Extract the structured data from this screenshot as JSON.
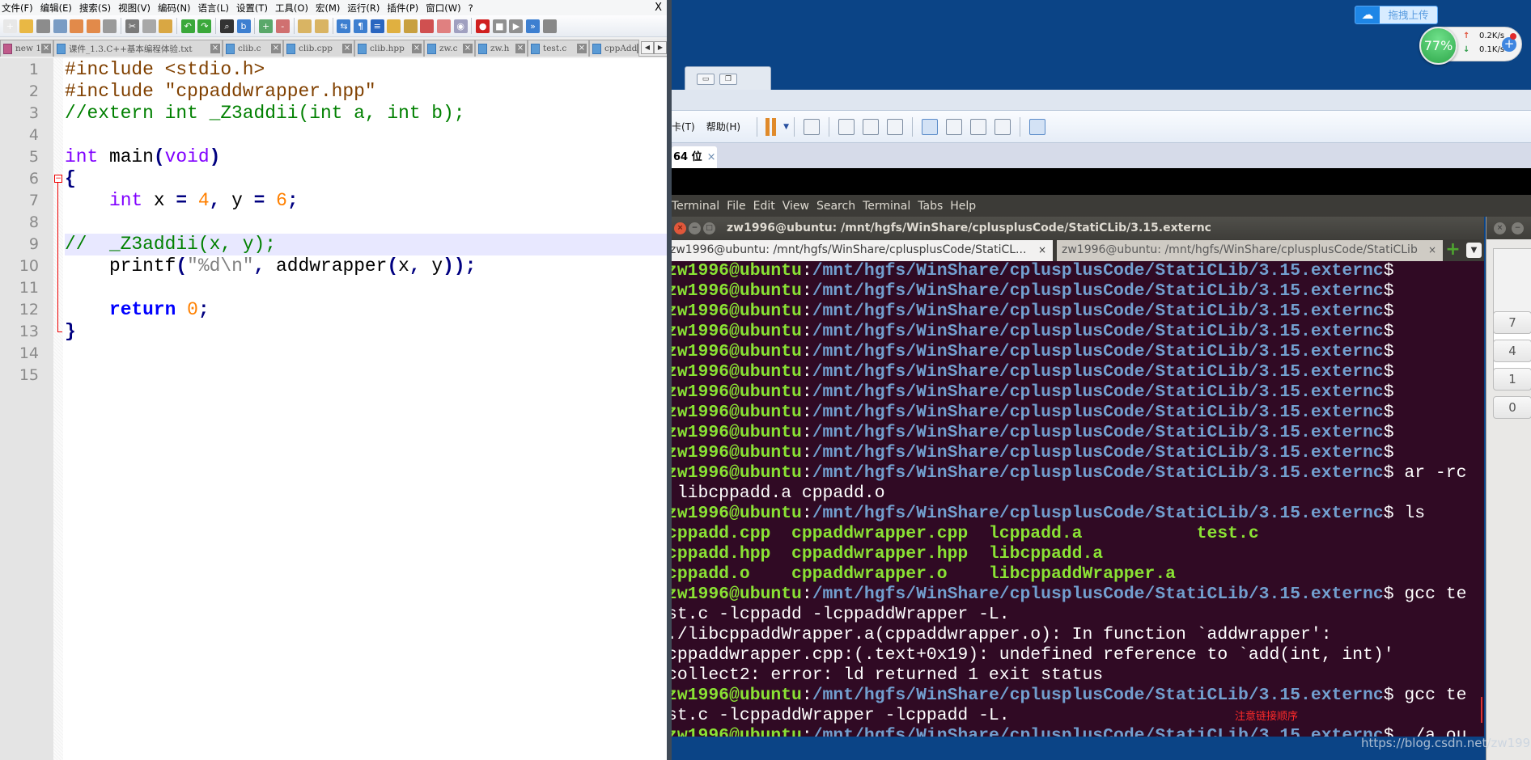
{
  "notepad": {
    "menu": [
      "文件(F)",
      "编辑(E)",
      "搜索(S)",
      "视图(V)",
      "编码(N)",
      "语言(L)",
      "设置(T)",
      "工具(O)",
      "宏(M)",
      "运行(R)",
      "插件(P)",
      "窗口(W)",
      "?"
    ],
    "close_label": "X",
    "toolbar_icons": [
      {
        "name": "new-file",
        "color": "#e8e8e8",
        "glyph": "+"
      },
      {
        "name": "open-file",
        "color": "#e9b844",
        "glyph": ""
      },
      {
        "name": "save",
        "color": "#8c8c8c",
        "glyph": ""
      },
      {
        "name": "save-all",
        "color": "#7a9cc4",
        "glyph": ""
      },
      {
        "name": "close-file",
        "color": "#e28a4a",
        "glyph": ""
      },
      {
        "name": "close-all",
        "color": "#e28a4a",
        "glyph": ""
      },
      {
        "name": "print",
        "color": "#9a9a9a",
        "glyph": ""
      },
      {
        "sep": true
      },
      {
        "name": "cut",
        "color": "#7a7a7a",
        "glyph": "✂"
      },
      {
        "name": "copy",
        "color": "#a8a8a8",
        "glyph": ""
      },
      {
        "name": "paste",
        "color": "#d9a743",
        "glyph": ""
      },
      {
        "sep": true
      },
      {
        "name": "undo",
        "color": "#3aa83a",
        "glyph": "↶"
      },
      {
        "name": "redo",
        "color": "#3aa83a",
        "glyph": "↷"
      },
      {
        "sep": true
      },
      {
        "name": "find",
        "color": "#333333",
        "glyph": "⌕"
      },
      {
        "name": "replace",
        "color": "#3d7fd0",
        "glyph": "b"
      },
      {
        "sep": true
      },
      {
        "name": "zoom-in",
        "color": "#5aa86a",
        "glyph": "+"
      },
      {
        "name": "zoom-out",
        "color": "#d07070",
        "glyph": "-"
      },
      {
        "sep": true
      },
      {
        "name": "sync-vertical",
        "color": "#d9b463",
        "glyph": ""
      },
      {
        "name": "sync-horizontal",
        "color": "#d9b463",
        "glyph": ""
      },
      {
        "sep": true
      },
      {
        "name": "word-wrap",
        "color": "#3d7fd0",
        "glyph": "⇆"
      },
      {
        "name": "show-all-chars",
        "color": "#3d7fd0",
        "glyph": "¶"
      },
      {
        "name": "indent-guide",
        "color": "#2a66c0",
        "glyph": "≡"
      },
      {
        "name": "doc-map",
        "color": "#e0b040",
        "glyph": ""
      },
      {
        "name": "function-list",
        "color": "#c8a040",
        "glyph": ""
      },
      {
        "name": "folder-workspace",
        "color": "#d05050",
        "glyph": ""
      },
      {
        "name": "doc-list",
        "color": "#e08080",
        "glyph": ""
      },
      {
        "name": "monitoring",
        "color": "#a0a0c0",
        "glyph": "◉"
      },
      {
        "sep": true
      },
      {
        "name": "record-macro",
        "color": "#d02020",
        "glyph": "●"
      },
      {
        "name": "stop-record",
        "color": "#909090",
        "glyph": "■"
      },
      {
        "name": "playback",
        "color": "#909090",
        "glyph": "▶"
      },
      {
        "name": "run-macro-multiple",
        "color": "#3d7fd0",
        "glyph": "»"
      },
      {
        "name": "save-macro",
        "color": "#888888",
        "glyph": ""
      }
    ],
    "tabs": [
      {
        "label": "new 1",
        "unsaved": true
      },
      {
        "label": "课件_1.3.C++基本编程体验.txt"
      },
      {
        "label": "clib.c"
      },
      {
        "label": "clib.cpp"
      },
      {
        "label": "clib.hpp"
      },
      {
        "label": "zw.c"
      },
      {
        "label": "zw.h"
      },
      {
        "label": "test.c"
      },
      {
        "label": "cppAdd"
      }
    ],
    "active_line": 9,
    "code": [
      {
        "num": "1",
        "tokens": [
          {
            "t": "#include <stdio.h>",
            "c": "pp"
          }
        ]
      },
      {
        "num": "2",
        "tokens": [
          {
            "t": "#include \"cppaddwrapper.hpp\"",
            "c": "pp"
          }
        ]
      },
      {
        "num": "3",
        "tokens": [
          {
            "t": "//extern int _Z3addii(int a, int b);",
            "c": "cm"
          }
        ]
      },
      {
        "num": "4",
        "tokens": []
      },
      {
        "num": "5",
        "tokens": [
          {
            "t": "int",
            "c": "kw"
          },
          {
            "t": " main"
          },
          {
            "t": "(",
            "c": "op"
          },
          {
            "t": "void",
            "c": "kw"
          },
          {
            "t": ")",
            "c": "op"
          }
        ]
      },
      {
        "num": "6",
        "tokens": [
          {
            "t": "{",
            "c": "op"
          }
        ]
      },
      {
        "num": "7",
        "tokens": [
          {
            "t": "    "
          },
          {
            "t": "int",
            "c": "kw"
          },
          {
            "t": " x "
          },
          {
            "t": "=",
            "c": "op"
          },
          {
            "t": " "
          },
          {
            "t": "4",
            "c": "nm"
          },
          {
            "t": ",",
            "c": "op"
          },
          {
            "t": " y "
          },
          {
            "t": "=",
            "c": "op"
          },
          {
            "t": " "
          },
          {
            "t": "6",
            "c": "nm"
          },
          {
            "t": ";",
            "c": "op"
          }
        ]
      },
      {
        "num": "8",
        "tokens": []
      },
      {
        "num": "9",
        "tokens": [
          {
            "t": "//  _Z3addii(x, y);",
            "c": "cm"
          }
        ]
      },
      {
        "num": "10",
        "tokens": [
          {
            "t": "    printf"
          },
          {
            "t": "(",
            "c": "op"
          },
          {
            "t": "\"%d\\n\"",
            "c": "st"
          },
          {
            "t": ",",
            "c": "op"
          },
          {
            "t": " addwrapper"
          },
          {
            "t": "(",
            "c": "op"
          },
          {
            "t": "x"
          },
          {
            "t": ",",
            "c": "op"
          },
          {
            "t": " y"
          },
          {
            "t": "));",
            "c": "op"
          }
        ]
      },
      {
        "num": "11",
        "tokens": []
      },
      {
        "num": "12",
        "tokens": [
          {
            "t": "    "
          },
          {
            "t": "return",
            "c": "rt"
          },
          {
            "t": " "
          },
          {
            "t": "0",
            "c": "nm"
          },
          {
            "t": ";",
            "c": "op"
          }
        ]
      },
      {
        "num": "13",
        "tokens": [
          {
            "t": "}",
            "c": "op"
          }
        ]
      },
      {
        "num": "14",
        "tokens": []
      },
      {
        "num": "15",
        "tokens": []
      }
    ]
  },
  "desktop": {
    "upload_label": "拖拽上传",
    "cpu_percent": "77%",
    "upload_speed": "0.2K/s",
    "download_speed": "0.1K/s",
    "watermark": "https://blog.csdn.net/zw1996"
  },
  "vmware": {
    "menu": [
      "卡(T)",
      "帮助(H)"
    ],
    "tab_label": "64 位",
    "tab_close": "×"
  },
  "terminal": {
    "menu": [
      "Terminal",
      "File",
      "Edit",
      "View",
      "Search",
      "Terminal",
      "Tabs",
      "Help"
    ],
    "title": "zw1996@ubuntu: /mnt/hgfs/WinShare/cplusplusCode/StatiCLib/3.15.externc",
    "tabs": [
      "zw1996@ubuntu: /mnt/hgfs/WinShare/cplusplusCode/StatiCL...",
      "zw1996@ubuntu: /mnt/hgfs/WinShare/cplusplusCode/StatiCLib"
    ],
    "tab_close": "×",
    "lines": [
      [
        {
          "t": "zw1996@ubuntu",
          "c": "u"
        },
        {
          "t": ":",
          "c": "w"
        },
        {
          "t": "/mnt/hgfs/WinShare/cplusplusCode/StatiCLib/3.15.externc",
          "c": "p"
        },
        {
          "t": "$",
          "c": "w"
        }
      ],
      [
        {
          "t": "zw1996@ubuntu",
          "c": "u"
        },
        {
          "t": ":",
          "c": "w"
        },
        {
          "t": "/mnt/hgfs/WinShare/cplusplusCode/StatiCLib/3.15.externc",
          "c": "p"
        },
        {
          "t": "$",
          "c": "w"
        }
      ],
      [
        {
          "t": "zw1996@ubuntu",
          "c": "u"
        },
        {
          "t": ":",
          "c": "w"
        },
        {
          "t": "/mnt/hgfs/WinShare/cplusplusCode/StatiCLib/3.15.externc",
          "c": "p"
        },
        {
          "t": "$",
          "c": "w"
        }
      ],
      [
        {
          "t": "zw1996@ubuntu",
          "c": "u"
        },
        {
          "t": ":",
          "c": "w"
        },
        {
          "t": "/mnt/hgfs/WinShare/cplusplusCode/StatiCLib/3.15.externc",
          "c": "p"
        },
        {
          "t": "$",
          "c": "w"
        }
      ],
      [
        {
          "t": "zw1996@ubuntu",
          "c": "u"
        },
        {
          "t": ":",
          "c": "w"
        },
        {
          "t": "/mnt/hgfs/WinShare/cplusplusCode/StatiCLib/3.15.externc",
          "c": "p"
        },
        {
          "t": "$",
          "c": "w"
        }
      ],
      [
        {
          "t": "zw1996@ubuntu",
          "c": "u"
        },
        {
          "t": ":",
          "c": "w"
        },
        {
          "t": "/mnt/hgfs/WinShare/cplusplusCode/StatiCLib/3.15.externc",
          "c": "p"
        },
        {
          "t": "$",
          "c": "w"
        }
      ],
      [
        {
          "t": "zw1996@ubuntu",
          "c": "u"
        },
        {
          "t": ":",
          "c": "w"
        },
        {
          "t": "/mnt/hgfs/WinShare/cplusplusCode/StatiCLib/3.15.externc",
          "c": "p"
        },
        {
          "t": "$",
          "c": "w"
        }
      ],
      [
        {
          "t": "zw1996@ubuntu",
          "c": "u"
        },
        {
          "t": ":",
          "c": "w"
        },
        {
          "t": "/mnt/hgfs/WinShare/cplusplusCode/StatiCLib/3.15.externc",
          "c": "p"
        },
        {
          "t": "$",
          "c": "w"
        }
      ],
      [
        {
          "t": "zw1996@ubuntu",
          "c": "u"
        },
        {
          "t": ":",
          "c": "w"
        },
        {
          "t": "/mnt/hgfs/WinShare/cplusplusCode/StatiCLib/3.15.externc",
          "c": "p"
        },
        {
          "t": "$",
          "c": "w"
        }
      ],
      [
        {
          "t": "zw1996@ubuntu",
          "c": "u"
        },
        {
          "t": ":",
          "c": "w"
        },
        {
          "t": "/mnt/hgfs/WinShare/cplusplusCode/StatiCLib/3.15.externc",
          "c": "p"
        },
        {
          "t": "$",
          "c": "w"
        }
      ],
      [
        {
          "t": "zw1996@ubuntu",
          "c": "u"
        },
        {
          "t": ":",
          "c": "w"
        },
        {
          "t": "/mnt/hgfs/WinShare/cplusplusCode/StatiCLib/3.15.externc",
          "c": "p"
        },
        {
          "t": "$ ar -rc",
          "c": "w"
        }
      ],
      [
        {
          "t": " libcppadd.a cppadd.o",
          "c": "w"
        }
      ],
      [
        {
          "t": "zw1996@ubuntu",
          "c": "u"
        },
        {
          "t": ":",
          "c": "w"
        },
        {
          "t": "/mnt/hgfs/WinShare/cplusplusCode/StatiCLib/3.15.externc",
          "c": "p"
        },
        {
          "t": "$ ls",
          "c": "w"
        }
      ],
      [
        {
          "t": "cppadd.cpp  cppaddwrapper.cpp  lcppadd.a           test.c",
          "c": "g"
        }
      ],
      [
        {
          "t": "cppadd.hpp  cppaddwrapper.hpp  libcppadd.a",
          "c": "g"
        }
      ],
      [
        {
          "t": "cppadd.o    cppaddwrapper.o    libcppaddWrapper.a",
          "c": "g"
        }
      ],
      [
        {
          "t": "zw1996@ubuntu",
          "c": "u"
        },
        {
          "t": ":",
          "c": "w"
        },
        {
          "t": "/mnt/hgfs/WinShare/cplusplusCode/StatiCLib/3.15.externc",
          "c": "p"
        },
        {
          "t": "$ gcc te",
          "c": "w"
        }
      ],
      [
        {
          "t": "st.c -lcppadd -lcppaddWrapper -L.",
          "c": "w"
        }
      ],
      [
        {
          "t": "./libcppaddWrapper.a(cppaddwrapper.o): In function `addwrapper':",
          "c": "w"
        }
      ],
      [
        {
          "t": "cppaddwrapper.cpp:(.text+0x19): undefined reference to `add(int, int)'",
          "c": "w"
        }
      ],
      [
        {
          "t": "collect2: error: ld returned 1 exit status",
          "c": "w"
        }
      ],
      [
        {
          "t": "zw1996@ubuntu",
          "c": "u"
        },
        {
          "t": ":",
          "c": "w"
        },
        {
          "t": "/mnt/hgfs/WinShare/cplusplusCode/StatiCLib/3.15.externc",
          "c": "p"
        },
        {
          "t": "$ gcc te",
          "c": "w"
        }
      ],
      [
        {
          "t": "st.c -lcppaddWrapper -lcppadd -L.",
          "c": "w"
        }
      ],
      [
        {
          "t": "zw1996@ubuntu",
          "c": "u"
        },
        {
          "t": ":",
          "c": "w"
        },
        {
          "t": "/mnt/hgfs/WinShare/cplusplusCode/StatiCLib/3.15.externc",
          "c": "p"
        },
        {
          "t": "$ ./a.ou",
          "c": "w"
        }
      ]
    ],
    "annotation": "注意链接顺序"
  },
  "calculator": {
    "keys": [
      "7",
      "4",
      "1",
      "0"
    ],
    "close": "×",
    "minimize": "−"
  }
}
